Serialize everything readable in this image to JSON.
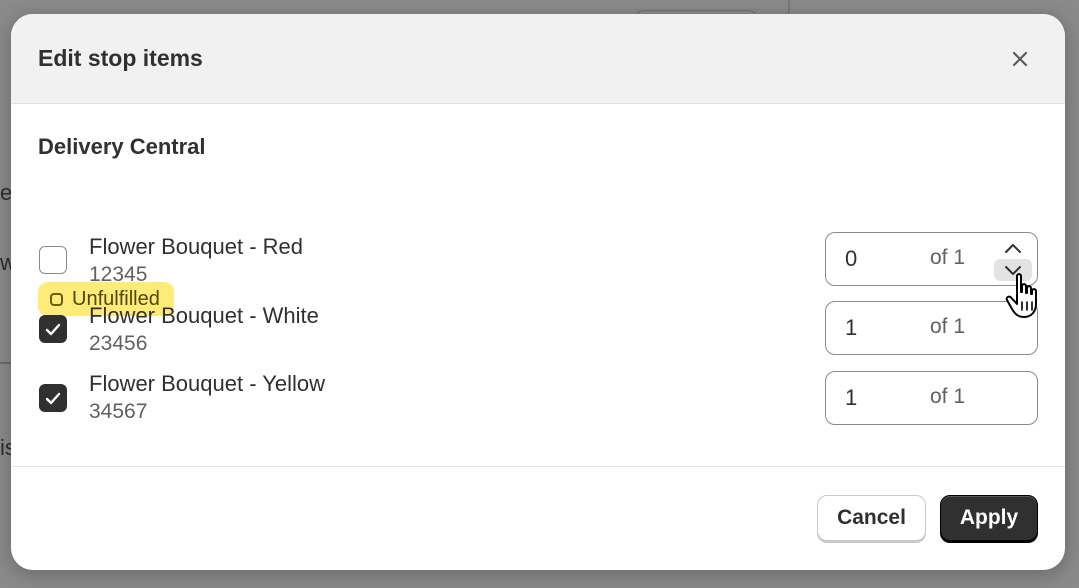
{
  "background": {
    "fragments": [
      "e",
      "w",
      "is"
    ]
  },
  "dialog": {
    "title": "Edit stop items",
    "close_icon": "close-icon"
  },
  "location": {
    "name": "Delivery Central",
    "status": "Unfulfilled",
    "status_color": "#ffeb78"
  },
  "items": [
    {
      "name": "Flower Bouquet - Red",
      "sku": "12345",
      "checked": false,
      "quantity": "0",
      "of_label": "of 1"
    },
    {
      "name": "Flower Bouquet - White",
      "sku": "23456",
      "checked": true,
      "quantity": "1",
      "of_label": "of 1"
    },
    {
      "name": "Flower Bouquet - Yellow",
      "sku": "34567",
      "checked": true,
      "quantity": "1",
      "of_label": "of 1"
    }
  ],
  "footer": {
    "cancel_label": "Cancel",
    "apply_label": "Apply"
  },
  "colors": {
    "primary_button": "#303030",
    "badge_bg": "#ffeb78"
  }
}
